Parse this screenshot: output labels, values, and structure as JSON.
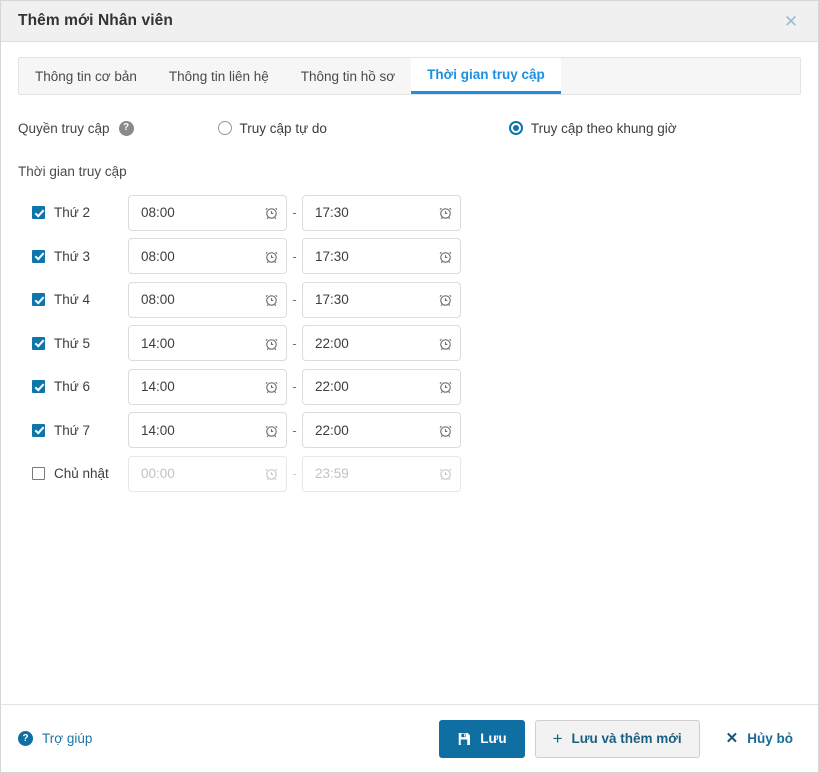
{
  "dialog": {
    "title": "Thêm mới Nhân viên",
    "close_icon": "close-icon"
  },
  "tabs": [
    {
      "label": "Thông tin cơ bản",
      "active": false
    },
    {
      "label": "Thông tin liên hệ",
      "active": false
    },
    {
      "label": "Thông tin hồ sơ",
      "active": false
    },
    {
      "label": "Thời gian truy cập",
      "active": true
    }
  ],
  "permission": {
    "label": "Quyền truy cập",
    "help_icon": "help-circle-icon",
    "options": [
      {
        "label": "Truy cập tự do",
        "checked": false
      },
      {
        "label": "Truy cập theo khung giờ",
        "checked": true
      }
    ]
  },
  "schedule": {
    "section_label": "Thời gian truy cập",
    "separator": "-",
    "clock_icon": "alarm-clock-icon",
    "rows": [
      {
        "day": "Thứ 2",
        "checked": true,
        "start": "08:00",
        "end": "17:30"
      },
      {
        "day": "Thứ 3",
        "checked": true,
        "start": "08:00",
        "end": "17:30"
      },
      {
        "day": "Thứ 4",
        "checked": true,
        "start": "08:00",
        "end": "17:30"
      },
      {
        "day": "Thứ 5",
        "checked": true,
        "start": "14:00",
        "end": "22:00"
      },
      {
        "day": "Thứ 6",
        "checked": true,
        "start": "14:00",
        "end": "22:00"
      },
      {
        "day": "Thứ 7",
        "checked": true,
        "start": "14:00",
        "end": "22:00"
      },
      {
        "day": "Chủ nhật",
        "checked": false,
        "start": "00:00",
        "end": "23:59"
      }
    ]
  },
  "footer": {
    "help_label": "Trợ giúp",
    "help_icon": "help-circle-icon",
    "save_label": "Lưu",
    "save_icon": "save-floppy-icon",
    "save_new_label": "Lưu và thêm mới",
    "save_new_icon": "plus-icon",
    "cancel_label": "Hủy bỏ",
    "cancel_icon": "close-x-icon"
  },
  "colors": {
    "accent": "#1b8fe0",
    "primary": "#0f6fa3",
    "checkbox": "#0f76ad",
    "header_bg": "#f0f0f0",
    "tabstrip_bg": "#f6f6f6"
  }
}
